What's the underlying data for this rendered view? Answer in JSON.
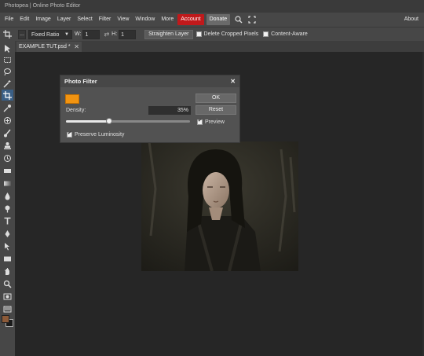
{
  "window": {
    "title": "Photopea | Online Photo Editor"
  },
  "menu": {
    "items": [
      "File",
      "Edit",
      "Image",
      "Layer",
      "Select",
      "Filter",
      "View",
      "Window",
      "More"
    ],
    "account": "Account",
    "donate": "Donate",
    "about": "About",
    "icons": [
      "search-icon",
      "fullscreen-icon"
    ]
  },
  "options": {
    "ellipsis": "...",
    "ratio_select": "Fixed Ratio",
    "w_label": "W:",
    "w_value": "1",
    "swap": "⇄",
    "h_label": "H:",
    "h_value": "1",
    "straighten": "Straighten Layer",
    "delete_cropped": "Delete Cropped Pixels",
    "delete_cropped_checked": false,
    "content_aware": "Content-Aware",
    "content_aware_checked": false
  },
  "tabs": [
    {
      "label": "EXAMPLE TUT.psd *",
      "close": "✕"
    }
  ],
  "tools": [
    "move-icon",
    "marquee-icon",
    "lasso-icon",
    "magic-wand-icon",
    "crop-icon",
    "eyedropper-icon",
    "healing-icon",
    "brush-icon",
    "stamp-icon",
    "history-brush-icon",
    "eraser-icon",
    "gradient-icon",
    "blur-icon",
    "dodge-icon",
    "type-icon",
    "pen-icon",
    "path-select-icon",
    "shape-icon",
    "hand-icon",
    "zoom-icon"
  ],
  "active_tool": "crop-icon",
  "colors": {
    "foreground": "#8c5a38",
    "background": "#1a1a1a",
    "accent": "#c0191b",
    "filter_color": "#f29411"
  },
  "dialog": {
    "title": "Photo Filter",
    "close": "✕",
    "density_label": "Density:",
    "density_value": "35%",
    "density": 0.35,
    "ok": "OK",
    "reset": "Reset",
    "preview": "Preview",
    "preview_checked": true,
    "preserve": "Preserve Luminosity",
    "preserve_checked": true
  }
}
